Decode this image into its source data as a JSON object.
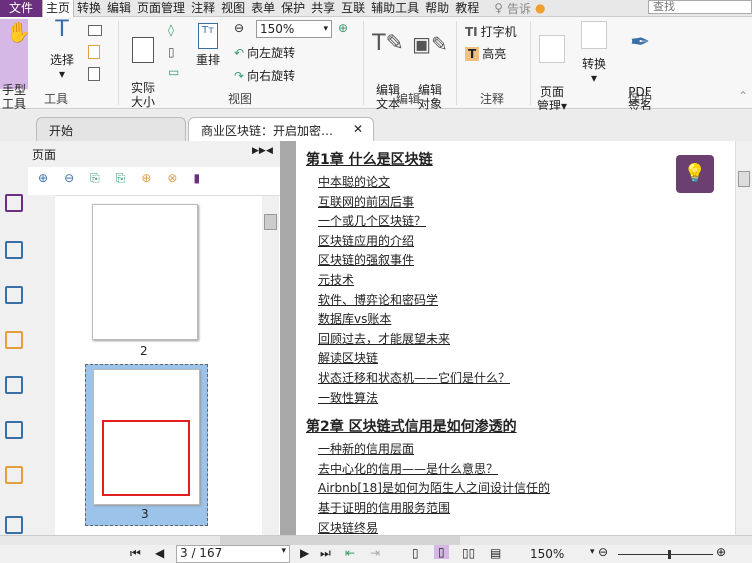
{
  "menu": {
    "file": "文件",
    "items": [
      "主页",
      "转换",
      "编辑",
      "页面管理",
      "注释",
      "视图",
      "表单",
      "保护",
      "共享",
      "互联",
      "辅助工具",
      "帮助",
      "教程"
    ],
    "tell": "告诉",
    "search_placeholder": "查找"
  },
  "ribbon": {
    "hand": "手型\n工具",
    "select": "选择",
    "actual_size": "实际\n大小",
    "reflow": "重排",
    "zoom": "150%",
    "rotate_left": "向左旋转",
    "rotate_right": "向右旋转",
    "edit_text": "编辑\n文本",
    "edit_object": "编辑\n对象",
    "typewriter": "打字机",
    "highlight": "高亮",
    "page_manage": "页面\n管理",
    "convert": "转换",
    "pdf_sign": "PDF\n签名",
    "groups": {
      "tools": "工具",
      "view": "视图",
      "edit": "编辑",
      "comment": "注释",
      "protect": "保护"
    }
  },
  "tabs": [
    {
      "label": "开始"
    },
    {
      "label": "商业区块链：开启加密…"
    }
  ],
  "panel": {
    "title": "页面",
    "pages": [
      "2",
      "3"
    ]
  },
  "document": {
    "chapters": [
      {
        "title": "第1章 什么是区块链",
        "items": [
          "中本聪的论文",
          "互联网的前因后事",
          "一个或几个区块链？",
          "区块链应用的介绍",
          "区块链的强叙事件",
          "元技术",
          "软件、博弈论和密码学",
          "数据库vs账本",
          "回顾过去，才能展望未来",
          "解读区块链",
          "状态迁移和状态机——它们是什么？",
          "一致性算法"
        ]
      },
      {
        "title": "第2章 区块链式信用是如何渗透的",
        "items": [
          "一种新的信用层面",
          "去中心化的信用——是什么意思？",
          "Airbnb[18]是如何为陌生人之间设计信任的",
          "基于证明的信用服务范围",
          "区块链终易"
        ]
      }
    ]
  },
  "status": {
    "page": "3 / 167",
    "zoom": "150%"
  }
}
